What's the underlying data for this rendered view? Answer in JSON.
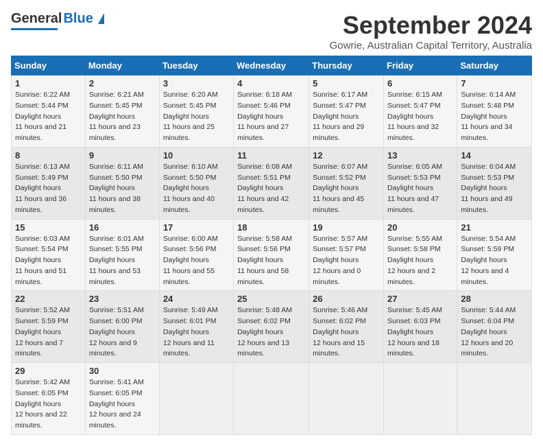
{
  "header": {
    "logo_line1": "General",
    "logo_line2": "Blue",
    "month": "September 2024",
    "location": "Gowrie, Australian Capital Territory, Australia"
  },
  "weekdays": [
    "Sunday",
    "Monday",
    "Tuesday",
    "Wednesday",
    "Thursday",
    "Friday",
    "Saturday"
  ],
  "weeks": [
    [
      {
        "day": "1",
        "sunrise": "6:22 AM",
        "sunset": "5:44 PM",
        "daylight": "11 hours and 21 minutes."
      },
      {
        "day": "2",
        "sunrise": "6:21 AM",
        "sunset": "5:45 PM",
        "daylight": "11 hours and 23 minutes."
      },
      {
        "day": "3",
        "sunrise": "6:20 AM",
        "sunset": "5:45 PM",
        "daylight": "11 hours and 25 minutes."
      },
      {
        "day": "4",
        "sunrise": "6:18 AM",
        "sunset": "5:46 PM",
        "daylight": "11 hours and 27 minutes."
      },
      {
        "day": "5",
        "sunrise": "6:17 AM",
        "sunset": "5:47 PM",
        "daylight": "11 hours and 29 minutes."
      },
      {
        "day": "6",
        "sunrise": "6:15 AM",
        "sunset": "5:47 PM",
        "daylight": "11 hours and 32 minutes."
      },
      {
        "day": "7",
        "sunrise": "6:14 AM",
        "sunset": "5:48 PM",
        "daylight": "11 hours and 34 minutes."
      }
    ],
    [
      {
        "day": "8",
        "sunrise": "6:13 AM",
        "sunset": "5:49 PM",
        "daylight": "11 hours and 36 minutes."
      },
      {
        "day": "9",
        "sunrise": "6:11 AM",
        "sunset": "5:50 PM",
        "daylight": "11 hours and 38 minutes."
      },
      {
        "day": "10",
        "sunrise": "6:10 AM",
        "sunset": "5:50 PM",
        "daylight": "11 hours and 40 minutes."
      },
      {
        "day": "11",
        "sunrise": "6:08 AM",
        "sunset": "5:51 PM",
        "daylight": "11 hours and 42 minutes."
      },
      {
        "day": "12",
        "sunrise": "6:07 AM",
        "sunset": "5:52 PM",
        "daylight": "11 hours and 45 minutes."
      },
      {
        "day": "13",
        "sunrise": "6:05 AM",
        "sunset": "5:53 PM",
        "daylight": "11 hours and 47 minutes."
      },
      {
        "day": "14",
        "sunrise": "6:04 AM",
        "sunset": "5:53 PM",
        "daylight": "11 hours and 49 minutes."
      }
    ],
    [
      {
        "day": "15",
        "sunrise": "6:03 AM",
        "sunset": "5:54 PM",
        "daylight": "11 hours and 51 minutes."
      },
      {
        "day": "16",
        "sunrise": "6:01 AM",
        "sunset": "5:55 PM",
        "daylight": "11 hours and 53 minutes."
      },
      {
        "day": "17",
        "sunrise": "6:00 AM",
        "sunset": "5:56 PM",
        "daylight": "11 hours and 55 minutes."
      },
      {
        "day": "18",
        "sunrise": "5:58 AM",
        "sunset": "5:56 PM",
        "daylight": "11 hours and 58 minutes."
      },
      {
        "day": "19",
        "sunrise": "5:57 AM",
        "sunset": "5:57 PM",
        "daylight": "12 hours and 0 minutes."
      },
      {
        "day": "20",
        "sunrise": "5:55 AM",
        "sunset": "5:58 PM",
        "daylight": "12 hours and 2 minutes."
      },
      {
        "day": "21",
        "sunrise": "5:54 AM",
        "sunset": "5:59 PM",
        "daylight": "12 hours and 4 minutes."
      }
    ],
    [
      {
        "day": "22",
        "sunrise": "5:52 AM",
        "sunset": "5:59 PM",
        "daylight": "12 hours and 7 minutes."
      },
      {
        "day": "23",
        "sunrise": "5:51 AM",
        "sunset": "6:00 PM",
        "daylight": "12 hours and 9 minutes."
      },
      {
        "day": "24",
        "sunrise": "5:49 AM",
        "sunset": "6:01 PM",
        "daylight": "12 hours and 11 minutes."
      },
      {
        "day": "25",
        "sunrise": "5:48 AM",
        "sunset": "6:02 PM",
        "daylight": "12 hours and 13 minutes."
      },
      {
        "day": "26",
        "sunrise": "5:46 AM",
        "sunset": "6:02 PM",
        "daylight": "12 hours and 15 minutes."
      },
      {
        "day": "27",
        "sunrise": "5:45 AM",
        "sunset": "6:03 PM",
        "daylight": "12 hours and 18 minutes."
      },
      {
        "day": "28",
        "sunrise": "5:44 AM",
        "sunset": "6:04 PM",
        "daylight": "12 hours and 20 minutes."
      }
    ],
    [
      {
        "day": "29",
        "sunrise": "5:42 AM",
        "sunset": "6:05 PM",
        "daylight": "12 hours and 22 minutes."
      },
      {
        "day": "30",
        "sunrise": "5:41 AM",
        "sunset": "6:05 PM",
        "daylight": "12 hours and 24 minutes."
      },
      null,
      null,
      null,
      null,
      null
    ]
  ],
  "labels": {
    "sunrise": "Sunrise:",
    "sunset": "Sunset:",
    "daylight": "Daylight hours"
  }
}
